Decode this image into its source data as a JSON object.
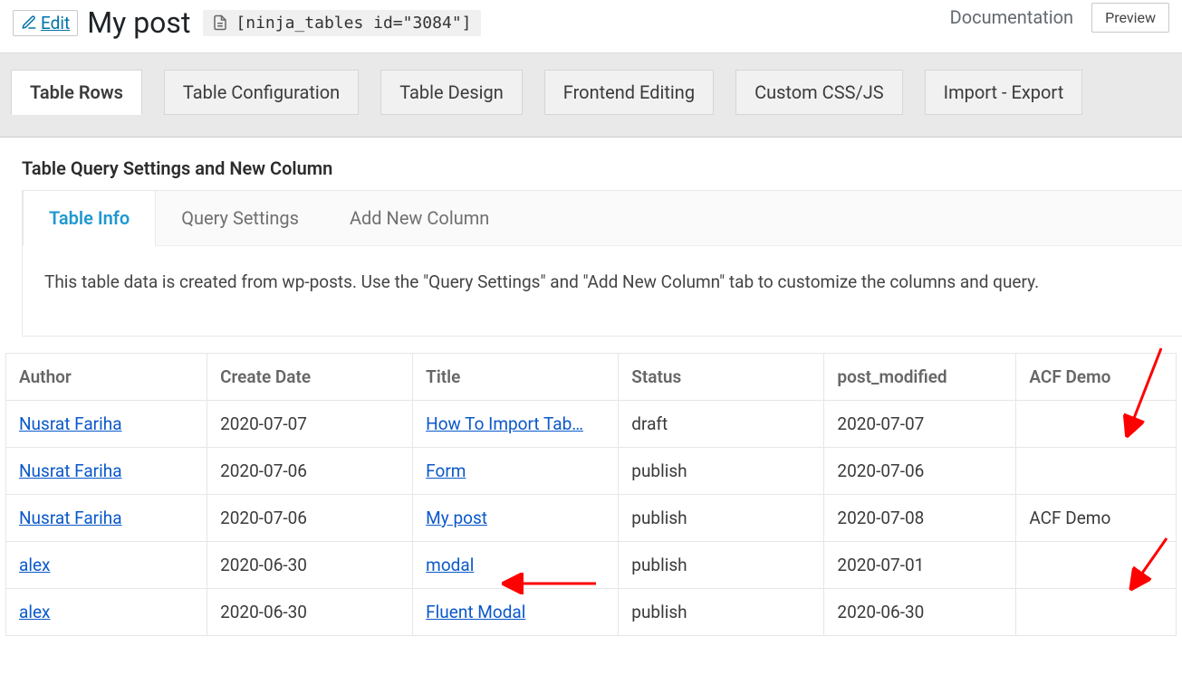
{
  "header": {
    "edit_label": "Edit",
    "title": "My post",
    "shortcode": "[ninja_tables id=\"3084\"]",
    "documentation_label": "Documentation",
    "preview_label": "Preview"
  },
  "main_tabs": [
    {
      "label": "Table Rows",
      "active": true
    },
    {
      "label": "Table Configuration",
      "active": false
    },
    {
      "label": "Table Design",
      "active": false
    },
    {
      "label": "Frontend Editing",
      "active": false
    },
    {
      "label": "Custom CSS/JS",
      "active": false
    },
    {
      "label": "Import - Export",
      "active": false
    }
  ],
  "section_title": "Table Query Settings and New Column",
  "sub_tabs": [
    {
      "label": "Table Info",
      "active": true
    },
    {
      "label": "Query Settings",
      "active": false
    },
    {
      "label": "Add New Column",
      "active": false
    }
  ],
  "panel_info_text": "This table data is created from wp-posts. Use the \"Query Settings\" and \"Add New Column\" tab to customize the columns and query.",
  "table": {
    "columns": [
      "Author",
      "Create Date",
      "Title",
      "Status",
      "post_modified",
      "ACF Demo"
    ],
    "rows": [
      {
        "author": "Nusrat Fariha",
        "create_date": "2020-07-07",
        "title": "How To Import Tab…",
        "status": "draft",
        "post_modified": "2020-07-07",
        "acf_demo": ""
      },
      {
        "author": "Nusrat Fariha",
        "create_date": "2020-07-06",
        "title": "Form",
        "status": "publish",
        "post_modified": "2020-07-06",
        "acf_demo": ""
      },
      {
        "author": "Nusrat Fariha",
        "create_date": "2020-07-06",
        "title": "My post",
        "status": "publish",
        "post_modified": "2020-07-08",
        "acf_demo": "ACF Demo"
      },
      {
        "author": "alex",
        "create_date": "2020-06-30",
        "title": "modal",
        "status": "publish",
        "post_modified": "2020-07-01",
        "acf_demo": ""
      },
      {
        "author": "alex",
        "create_date": "2020-06-30",
        "title": "Fluent Modal",
        "status": "publish",
        "post_modified": "2020-06-30",
        "acf_demo": ""
      }
    ]
  }
}
